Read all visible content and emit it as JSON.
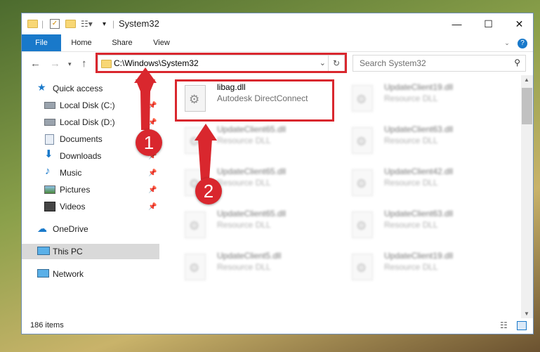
{
  "window": {
    "title": "System32"
  },
  "ribbon": {
    "tabs": [
      "File",
      "Home",
      "Share",
      "View"
    ]
  },
  "address": {
    "path": "C:\\Windows\\System32"
  },
  "search": {
    "placeholder": "Search System32"
  },
  "nav": {
    "items": [
      {
        "label": "Quick access",
        "icon": "star-icon"
      },
      {
        "label": "Local Disk (C:)",
        "icon": "drive-icon",
        "pinned": true
      },
      {
        "label": "Local Disk (D:)",
        "icon": "drive-icon",
        "pinned": true
      },
      {
        "label": "Documents",
        "icon": "documents-icon",
        "pinned": true
      },
      {
        "label": "Downloads",
        "icon": "download-icon",
        "pinned": true
      },
      {
        "label": "Music",
        "icon": "music-icon",
        "pinned": true
      },
      {
        "label": "Pictures",
        "icon": "pictures-icon",
        "pinned": true
      },
      {
        "label": "Videos",
        "icon": "videos-icon",
        "pinned": true
      },
      {
        "label": "OneDrive",
        "icon": "cloud-icon"
      },
      {
        "label": "This PC",
        "icon": "computer-icon",
        "selected": true
      },
      {
        "label": "Network",
        "icon": "network-icon"
      }
    ]
  },
  "files": {
    "highlighted": {
      "name": "libag.dll",
      "description": "Autodesk DirectConnect"
    },
    "others": [
      {
        "name": "UpdateClient19.dll",
        "description": "Resource DLL"
      },
      {
        "name": "UpdateClient65.dll",
        "description": "Resource DLL"
      },
      {
        "name": "UpdateClient63.dll",
        "description": "Resource DLL"
      },
      {
        "name": "UpdateClient65.dll",
        "description": "Resource DLL"
      },
      {
        "name": "UpdateClient42.dll",
        "description": "Resource DLL"
      },
      {
        "name": "UpdateClient65.dll",
        "description": "Resource DLL"
      },
      {
        "name": "UpdateClient63.dll",
        "description": "Resource DLL"
      },
      {
        "name": "UpdateClient5.dll",
        "description": "Resource DLL"
      },
      {
        "name": "UpdateClient19.dll",
        "description": "Resource DLL"
      }
    ]
  },
  "status": {
    "item_count": "186 items"
  },
  "annotations": {
    "step1": "1",
    "step2": "2",
    "color": "#d9272e"
  }
}
